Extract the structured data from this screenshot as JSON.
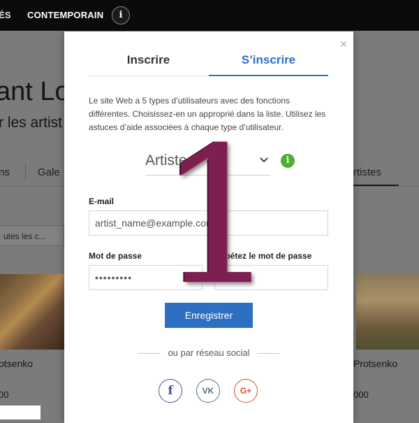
{
  "topbar": {
    "nav_item_1": "ÉS",
    "nav_item_2": "CONTEMPORAIN",
    "info_glyph": "i"
  },
  "background": {
    "title": "ant Lo",
    "subtitle": "r les artist",
    "tabs": [
      "ns",
      "Gale",
      "rtistes"
    ],
    "filter_select": "utes les c...",
    "cards": [
      {
        "name": "otsenko",
        "price": "00"
      },
      {
        "name": "Protsenko",
        "price": "000"
      }
    ]
  },
  "modal": {
    "close_glyph": "×",
    "tabs": {
      "login": "Inscrire",
      "signup": "S’inscrire"
    },
    "description": "Le site Web a 5 types d’utilisateurs avec des fonctions différentes. Choisissez-en un approprié dans la liste. Utilisez les astuces d’aide associées à chaque type d’utilisateur.",
    "role_select": {
      "value": "Artiste",
      "info_glyph": "i"
    },
    "email": {
      "label": "E-mail",
      "value": "artist_name@example.com"
    },
    "password": {
      "label": "Mot de passe",
      "value": "•••••••••"
    },
    "password_repeat": {
      "label": "Répétez le mot de passe",
      "value": ""
    },
    "register_button": "Enregistrer",
    "social_text": "ou par réseau social",
    "social": {
      "facebook": "f",
      "vk": "VK",
      "google": "G+"
    }
  },
  "overlay": {
    "step_number": "1"
  },
  "colors": {
    "accent": "#2d6fc2",
    "info_green": "#4caf2e",
    "numeral": "#7e1f52"
  }
}
